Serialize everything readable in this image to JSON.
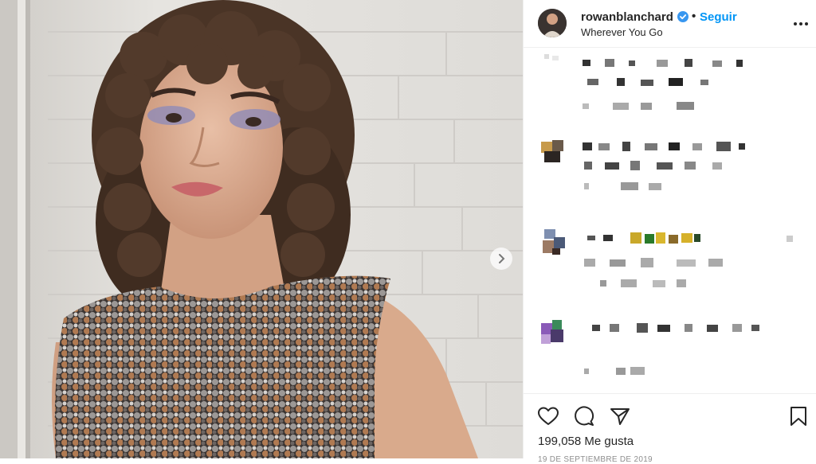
{
  "post": {
    "username": "rowanblanchard",
    "follow_separator": "•",
    "follow_label": "Seguir",
    "location": "Wherever You Go",
    "likes_text": "199,058 Me gusta",
    "date_text": "19 DE SEPTIEMBRE DE 2019"
  },
  "icons": {
    "verified": "verified-badge-icon",
    "more": "more-options-icon",
    "next": "chevron-right-icon",
    "like": "heart-icon",
    "comment": "comment-icon",
    "share": "share-icon",
    "save": "bookmark-icon"
  },
  "colors": {
    "accent": "#0095f6",
    "text": "#262626",
    "border": "#efefef"
  }
}
